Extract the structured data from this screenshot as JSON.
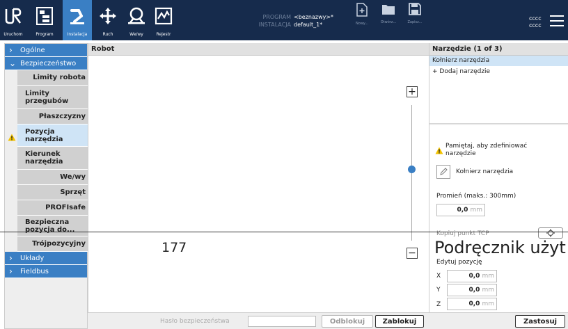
{
  "topbar": {
    "buttons": [
      {
        "label": "Uruchom"
      },
      {
        "label": "Program"
      },
      {
        "label": "Instalacja"
      },
      {
        "label": "Ruch"
      },
      {
        "label": "We/wy"
      },
      {
        "label": "Rejestr"
      }
    ],
    "program_key": "PROGRAM",
    "program_value": "<beznazwy>*",
    "installation_key": "INSTALACJA",
    "installation_value": "default_1*",
    "file_buttons": [
      {
        "label": "Nowy..."
      },
      {
        "label": "Otwórz..."
      },
      {
        "label": "Zapisz..."
      }
    ],
    "user_line1": "cccc",
    "user_line2": "cccc"
  },
  "nav": {
    "sections": [
      {
        "label": "Ogólne"
      },
      {
        "label": "Bezpieczeństwo"
      },
      {
        "label": "Układy"
      },
      {
        "label": "Fieldbus"
      }
    ],
    "safety_items": [
      {
        "label": "Limity robota"
      },
      {
        "label": "Limity przegubów"
      },
      {
        "label": "Płaszczyzny"
      },
      {
        "label": "Pozycja narzędzia"
      },
      {
        "label": "Kierunek narzędzia"
      },
      {
        "label": "We/wy"
      },
      {
        "label": "Sprzęt"
      },
      {
        "label": "PROFIsafe"
      },
      {
        "label": "Bezpieczna pozycja do..."
      },
      {
        "label": "Trójpozycyjny"
      }
    ]
  },
  "middle": {
    "title": "Robot",
    "zoom_in": "+",
    "zoom_out": "−"
  },
  "right": {
    "title": "Narzędzie (1 of 3)",
    "selected_tool": "Kołnierz narzędzia",
    "add_tool": "+ Dodaj narzędzie",
    "warning": "Pamiętaj, aby zdefiniować narzędzie",
    "tool_name": "Kołnierz narzędzia",
    "radius_label": "Promień (maks.: 300mm)",
    "radius_value": "0,0",
    "unit": "mm",
    "copy_tcp_label": "Kopiuj punkt TCP",
    "edit_position_label": "Edytuj pozycję",
    "x_label": "X",
    "y_label": "Y",
    "z_label": "Z",
    "x_value": "0,0",
    "y_value": "0,0",
    "z_value": "0,0"
  },
  "bottom": {
    "password_label": "Hasło bezpieczeństwa",
    "password_value": "",
    "unlock": "Odblokuj",
    "lock": "Zablokuj",
    "apply": "Zastosuj"
  },
  "footer": {
    "page_number": "177",
    "manual_title": "Podręcznik użyt"
  },
  "colors": {
    "topbar_bg": "#162b4c",
    "accent": "#3a7fc4",
    "selected_bg": "#cfe4f6",
    "warning": "#f2c200"
  }
}
